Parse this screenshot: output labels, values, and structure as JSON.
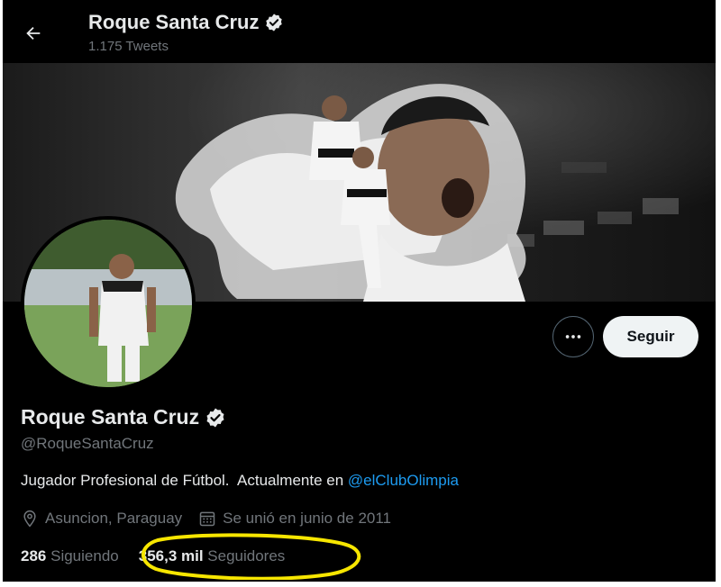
{
  "header": {
    "back_icon": "arrow-left-icon",
    "title": "Roque Santa Cruz",
    "tweet_count": "1.175 Tweets"
  },
  "actions": {
    "more_icon": "more-horizontal-icon",
    "follow_label": "Seguir"
  },
  "profile": {
    "name": "Roque Santa Cruz",
    "verified_icon": "verified-badge-icon",
    "handle": "@RoqueSantaCruz",
    "bio_text": "Jugador Profesional de Fútbol.  Actualmente en ",
    "bio_link": "@elClubOlimpia",
    "location": "Asuncion, Paraguay",
    "location_icon": "location-pin-icon",
    "joined": "Se unió en junio de 2011",
    "joined_icon": "calendar-icon"
  },
  "stats": {
    "following_count": "286",
    "following_label": "Siguiendo",
    "followers_count": "356,3 mil",
    "followers_label": "Seguidores"
  },
  "colors": {
    "background": "#000000",
    "text_primary": "#e7e9ea",
    "text_secondary": "#71767b",
    "link": "#1d9bf0",
    "highlight_annotation": "#f7e600"
  }
}
